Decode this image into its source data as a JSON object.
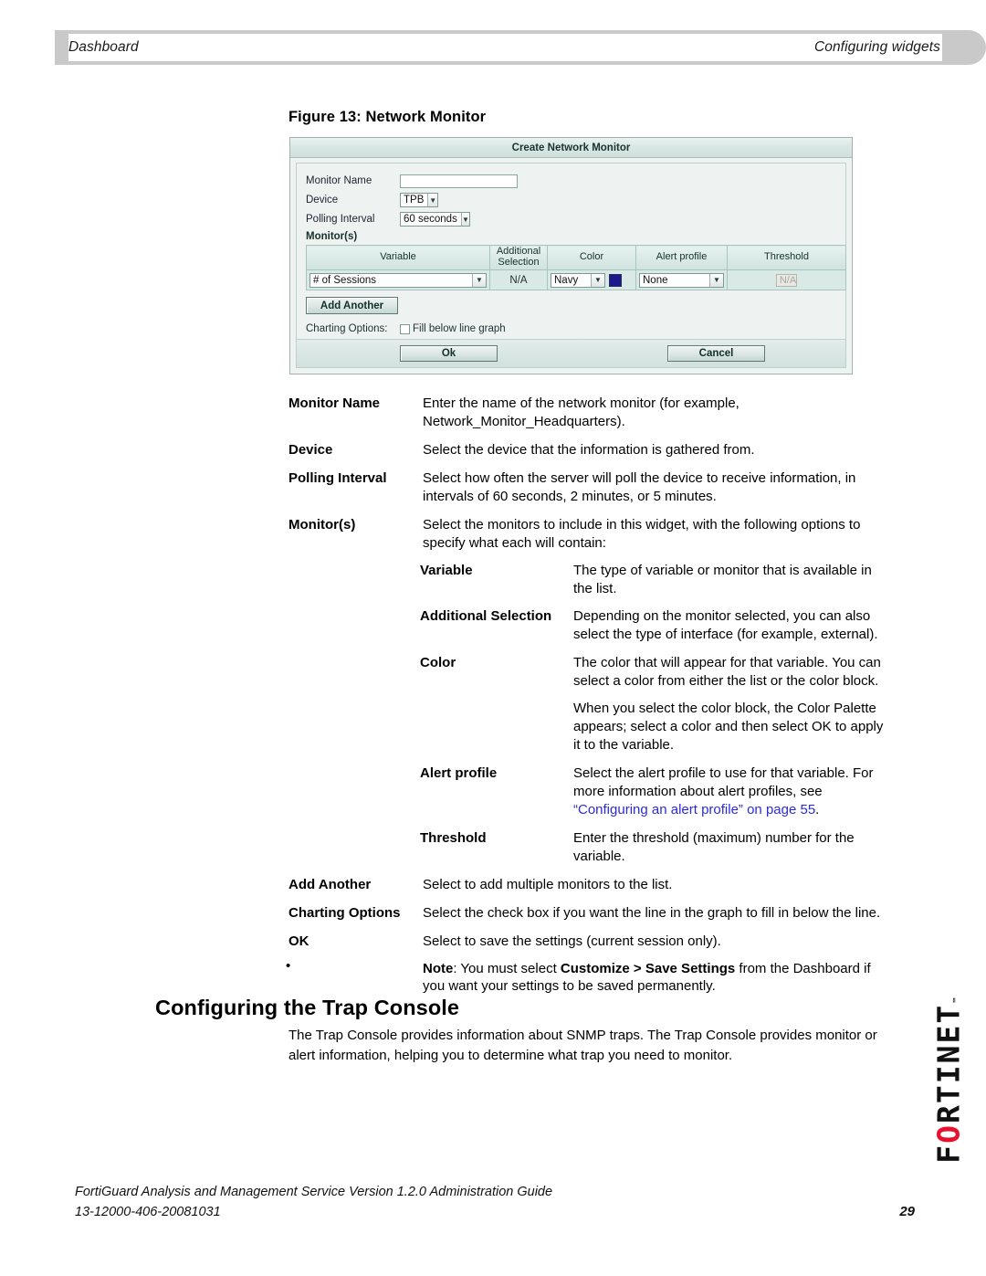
{
  "header": {
    "left": "Dashboard",
    "right": "Configuring widgets"
  },
  "figure": {
    "caption": "Figure 13: Network Monitor",
    "dialog": {
      "title": "Create Network Monitor",
      "fields": {
        "monitor_name_label": "Monitor Name",
        "monitor_name_value": "",
        "device_label": "Device",
        "device_value": "TPB",
        "polling_label": "Polling Interval",
        "polling_value": "60 seconds"
      },
      "monitors_section_label": "Monitor(s)",
      "table": {
        "headers": [
          "Variable",
          "Additional Selection",
          "Color",
          "Alert profile",
          "Threshold"
        ],
        "row": {
          "variable": "# of Sessions",
          "additional_selection": "N/A",
          "color": "Navy",
          "color_swatch_hex": "#1a1a8c",
          "alert_profile": "None",
          "threshold_placeholder": "N/A"
        }
      },
      "add_another_label": "Add Another",
      "charting_options_label": "Charting Options:",
      "fill_below_label": "Fill below line graph",
      "ok_label": "Ok",
      "cancel_label": "Cancel"
    }
  },
  "definitions": {
    "monitor_name": {
      "term": "Monitor Name",
      "desc": "Enter the name of the network monitor (for example, Network_Monitor_Headquarters)."
    },
    "device": {
      "term": "Device",
      "desc": "Select the device that the information is gathered from."
    },
    "polling_interval": {
      "term": "Polling Interval",
      "desc": "Select how often the server will poll the device to receive information, in intervals of 60 seconds, 2 minutes, or 5 minutes."
    },
    "monitors": {
      "term": "Monitor(s)",
      "desc": "Select the monitors to include in this widget, with the following options to specify what each will contain:"
    },
    "variable": {
      "term": "Variable",
      "desc": "The type of variable or monitor that is available in the list."
    },
    "additional_selection": {
      "term": "Additional Selection",
      "desc": "Depending on the monitor selected, you can also select the type of interface (for example, external)."
    },
    "color": {
      "term": "Color",
      "desc_p1": "The color that will appear for that variable. You can select a color from either the list or the color block.",
      "desc_p2": "When you select the color block, the Color Palette appears; select a color and then select OK to apply it to the variable."
    },
    "alert_profile": {
      "term": "Alert profile",
      "desc_pre": "Select the alert profile to use for that variable. For more information about alert profiles, see ",
      "link": "“Configuring an alert profile” on page 55",
      "desc_post": "."
    },
    "threshold": {
      "term": "Threshold",
      "desc": "Enter the threshold (maximum) number for the variable."
    },
    "add_another": {
      "term": "Add Another",
      "desc": "Select to add multiple monitors to the list."
    },
    "charting_options": {
      "term": "Charting Options",
      "desc": "Select the check box if you want the line in the graph to fill in below the line."
    },
    "ok": {
      "term": "OK",
      "desc": "Select to save the settings (current session only).",
      "note_label": "Note",
      "note_pre": ": You must select ",
      "note_bold": "Customize > Save Settings",
      "note_post": " from the Dashboard if you want your settings to be saved permanently."
    }
  },
  "bullet": "•",
  "section": {
    "heading": "Configuring the Trap Console",
    "body": "The Trap Console provides information about SNMP traps. The Trap Console provides monitor or alert information, helping you to determine what trap you need to monitor."
  },
  "logo": {
    "text": "F",
    "red_letter": "O",
    "rest": "RTINET",
    "tm": "™"
  },
  "footer": {
    "line1": "FortiGuard Analysis and Management Service Version 1.2.0 Administration Guide",
    "line2": "13-12000-406-20081031",
    "page": "29"
  }
}
